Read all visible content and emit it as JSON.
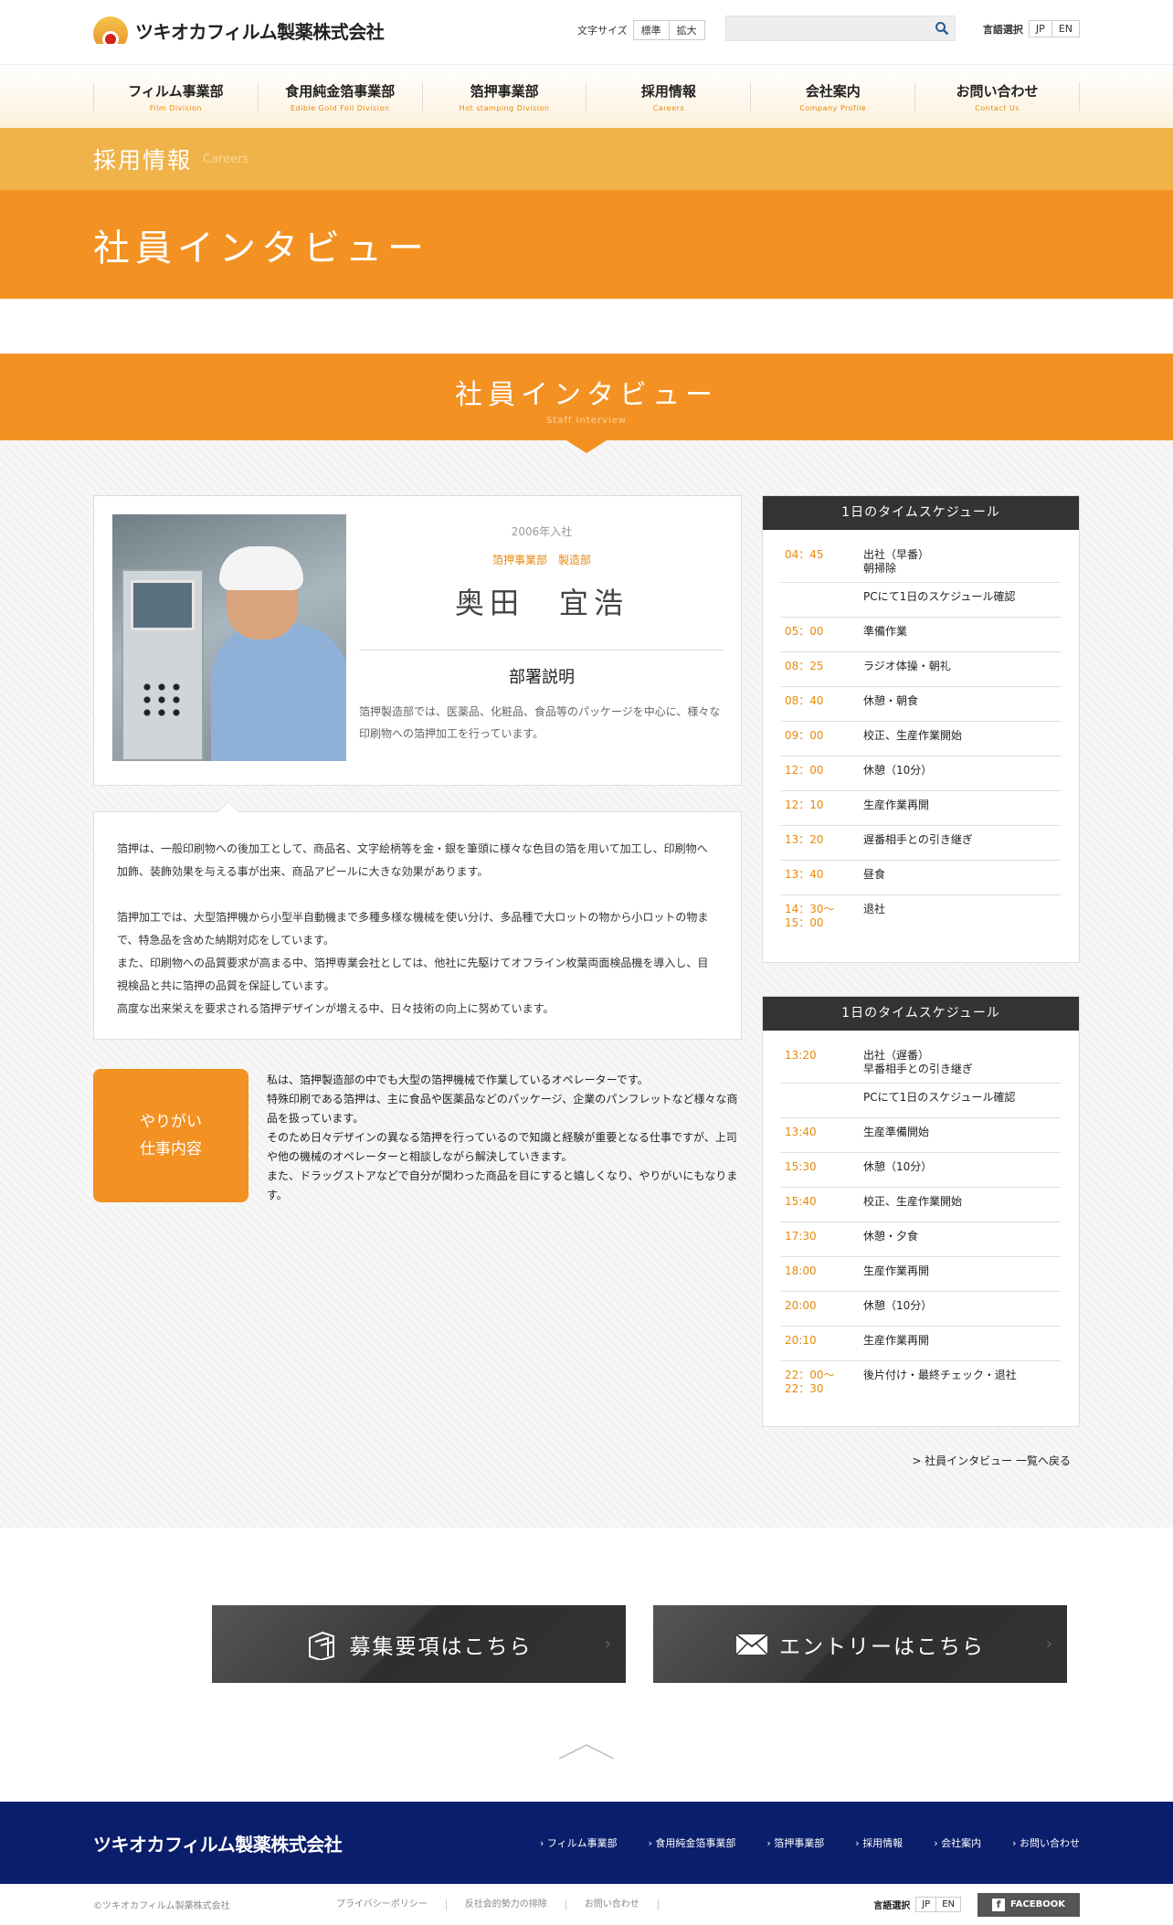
{
  "header": {
    "logo_text": "ツキオカフィルム製薬株式会社",
    "fontsize": {
      "label": "文字サイズ",
      "options": [
        "標準",
        "拡大"
      ]
    },
    "search": {
      "placeholder": ""
    },
    "lang": {
      "label": "言語選択",
      "options": [
        "JP",
        "EN"
      ]
    }
  },
  "nav": [
    {
      "jp": "フィルム事業部",
      "en": "Film Division"
    },
    {
      "jp": "食用純金箔事業部",
      "en": "Edible Gold Foil Division"
    },
    {
      "jp": "箔押事業部",
      "en": "Hot stamping Division"
    },
    {
      "jp": "採用情報",
      "en": "Careers"
    },
    {
      "jp": "会社案内",
      "en": "Company Profile"
    },
    {
      "jp": "お問い合わせ",
      "en": "Contact Us"
    }
  ],
  "band1": {
    "title": "採用情報",
    "en": "Careers"
  },
  "band2": {
    "title": "社員インタビュー"
  },
  "section": {
    "title": "社員インタビュー",
    "en": "Staff Interview"
  },
  "profile": {
    "year": "2006年入社",
    "dept": "箔押事業部　製造部",
    "name": "奥田　宜浩",
    "dept_head": "部署説明",
    "dept_desc": "箔押製造部では、医薬品、化粧品、食品等のパッケージを中心に、様々な印刷物への箔押加工を行っています。"
  },
  "detail": {
    "p1": "箔押は、一般印刷物への後加工として、商品名、文字絵柄等を金・銀を筆頭に様々な色目の箔を用いて加工し、印刷物へ加飾、装飾効果を与える事が出来、商品アピールに大きな効果があります。",
    "p2": "箔押加工では、大型箔押機から小型半自動機まで多種多様な機械を使い分け、多品種で大ロットの物から小ロットの物まで、特急品を含めた納期対応をしています。",
    "p3": "また、印刷物への品質要求が高まる中、箔押専業会社としては、他社に先駆けてオフライン枚葉両面検品機を導入し、目視検品と共に箔押の品質を保証しています。",
    "p4": "高度な出来栄えを要求される箔押デザインが増える中、日々技術の向上に努めています。"
  },
  "yarigai": {
    "line1": "やりがい",
    "line2": "仕事内容",
    "text1": "私は、箔押製造部の中でも大型の箔押機械で作業しているオペレーターです。",
    "text2": "特殊印刷である箔押は、主に食品や医薬品などのパッケージ、企業のパンフレットなど様々な商品を扱っています。",
    "text3": "そのため日々デザインの異なる箔押を行っているので知識と経験が重要となる仕事ですが、上司や他の機械のオペレーターと相談しながら解決していきます。",
    "text4": "また、ドラッグストアなどで自分が関わった商品を目にすると嬉しくなり、やりがいにもなります。"
  },
  "schedule1": {
    "title": "1日のタイムスケジュール",
    "rows": [
      {
        "time": "04：45",
        "act": "出社（早番）\n朝掃除"
      },
      {
        "time": "",
        "act": "PCにて1日のスケジュール確認"
      },
      {
        "time": "05：00",
        "act": "準備作業"
      },
      {
        "time": "08：25",
        "act": "ラジオ体操・朝礼"
      },
      {
        "time": "08：40",
        "act": "休憩・朝食"
      },
      {
        "time": "09：00",
        "act": "校正、生産作業開始"
      },
      {
        "time": "12：00",
        "act": "休憩（10分）"
      },
      {
        "time": "12：10",
        "act": "生産作業再開"
      },
      {
        "time": "13：20",
        "act": "遅番相手との引き継ぎ"
      },
      {
        "time": "13：40",
        "act": "昼食"
      },
      {
        "time": "14：30〜\n15：00",
        "act": "退社"
      }
    ]
  },
  "schedule2": {
    "title": "1日のタイムスケジュール",
    "rows": [
      {
        "time": "13:20",
        "act": "出社（遅番）\n早番相手との引き継ぎ"
      },
      {
        "time": "",
        "act": "PCにて1日のスケジュール確認"
      },
      {
        "time": "13:40",
        "act": "生産準備開始"
      },
      {
        "time": "15:30",
        "act": "休憩（10分）"
      },
      {
        "time": "15:40",
        "act": "校正、生産作業開始"
      },
      {
        "time": "17:30",
        "act": "休憩・夕食"
      },
      {
        "time": "18:00",
        "act": "生産作業再開"
      },
      {
        "time": "20:00",
        "act": "休憩（10分）"
      },
      {
        "time": "20:10",
        "act": "生産作業再開"
      },
      {
        "time": "22：00〜\n22：30",
        "act": "後片付け・最終チェック・退社"
      }
    ]
  },
  "backlink": "> 社員インタビュー 一覧へ戻る",
  "buttons": {
    "recruit": "募集要項はこちら",
    "entry": "エントリーはこちら"
  },
  "footer": {
    "logo_text": "ツキオカフィルム製薬株式会社",
    "links": [
      "フィルム事業部",
      "食用純金箔事業部",
      "箔押事業部",
      "採用情報",
      "会社案内",
      "お問い合わせ"
    ],
    "copyright": "©ツキオカフィルム製薬株式会社",
    "policy_links": [
      "プライバシーポリシー",
      "反社会的勢力の排除",
      "お問い合わせ"
    ],
    "lang": {
      "label": "言語選択",
      "options": [
        "JP",
        "EN"
      ]
    },
    "facebook": "FACEBOOK"
  },
  "colors": {
    "accent": "#f39223",
    "band_light": "#f0b34a",
    "footer": "#0a1e6b",
    "dark_button": "#333333"
  }
}
